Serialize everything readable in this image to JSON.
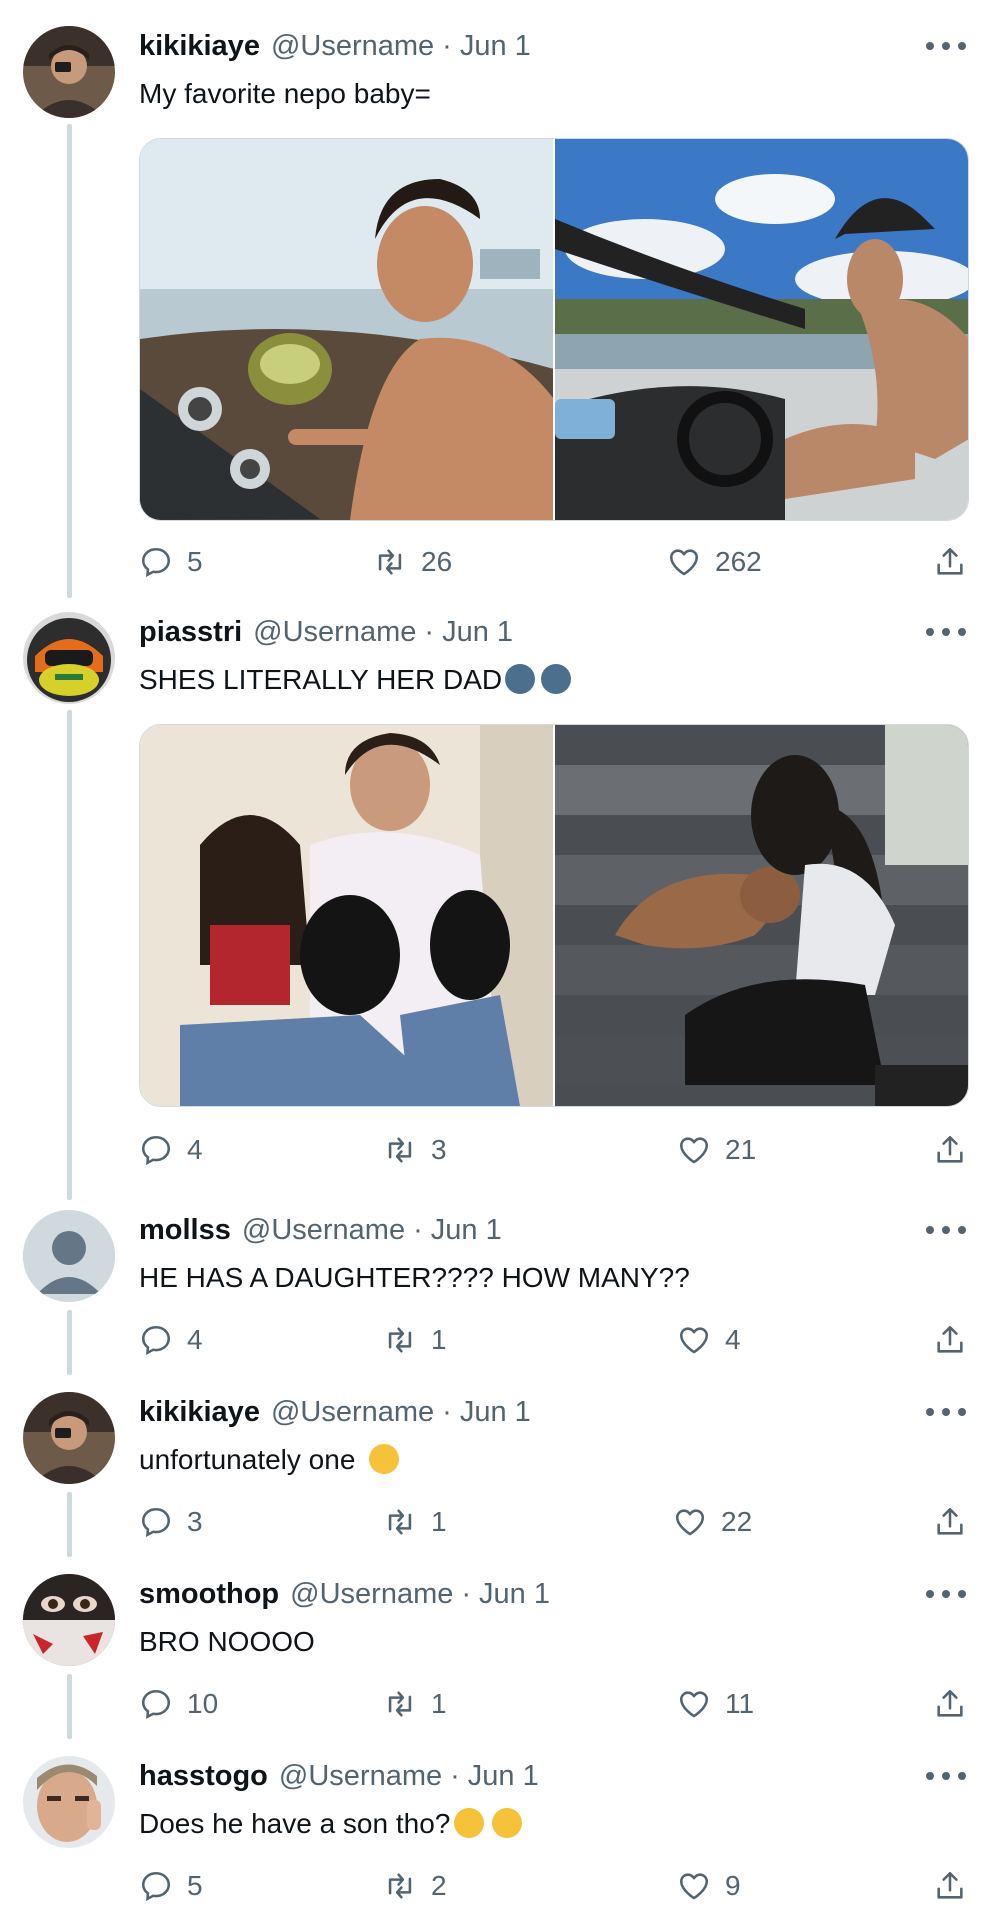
{
  "tweets": [
    {
      "name": "kikikiaye",
      "handle": "@Username",
      "date": "Jun 1",
      "text": "My favorite nepo baby=",
      "media_alt": [
        "man drinking from a coconut on a speedboat",
        "woman in a cap driving a speedboat"
      ],
      "replies": "5",
      "retweets": "26",
      "likes": "262"
    },
    {
      "name": "piasstri",
      "handle": "@Username",
      "date": "Jun 1",
      "text": "SHES LITERALLY HER DAD",
      "emoji": [
        "speaking-head-emoji",
        "speaking-head-emoji"
      ],
      "media_alt": [
        "man and girl with two black puppies",
        "woman petting a brown dog on stairs"
      ],
      "replies": "4",
      "retweets": "3",
      "likes": "21"
    },
    {
      "name": "mollss",
      "handle": "@Username",
      "date": "Jun 1",
      "text": "HE HAS A DAUGHTER???? HOW MANY??",
      "replies": "4",
      "retweets": "1",
      "likes": "4"
    },
    {
      "name": "kikikiaye",
      "handle": "@Username",
      "date": "Jun 1",
      "text": "unfortunately one",
      "emoji": [
        "crying-face-emoji"
      ],
      "replies": "3",
      "retweets": "1",
      "likes": "22"
    },
    {
      "name": "smoothop",
      "handle": "@Username",
      "date": "Jun 1",
      "text": "BRO NOOOO",
      "replies": "10",
      "retweets": "1",
      "likes": "11"
    },
    {
      "name": "hasstogo",
      "handle": "@Username",
      "date": "Jun 1",
      "text": "Does he have a son tho?",
      "emoji": [
        "hand-over-mouth-emoji",
        "hand-over-mouth-emoji"
      ],
      "replies": "5",
      "retweets": "2",
      "likes": "9"
    }
  ],
  "separator": "·",
  "colors": {
    "text": "#0f1419",
    "secondary": "#536471",
    "thread_line": "#cfd9de"
  },
  "icons": [
    "reply-icon",
    "retweet-icon",
    "like-icon",
    "share-icon",
    "more-icon"
  ]
}
